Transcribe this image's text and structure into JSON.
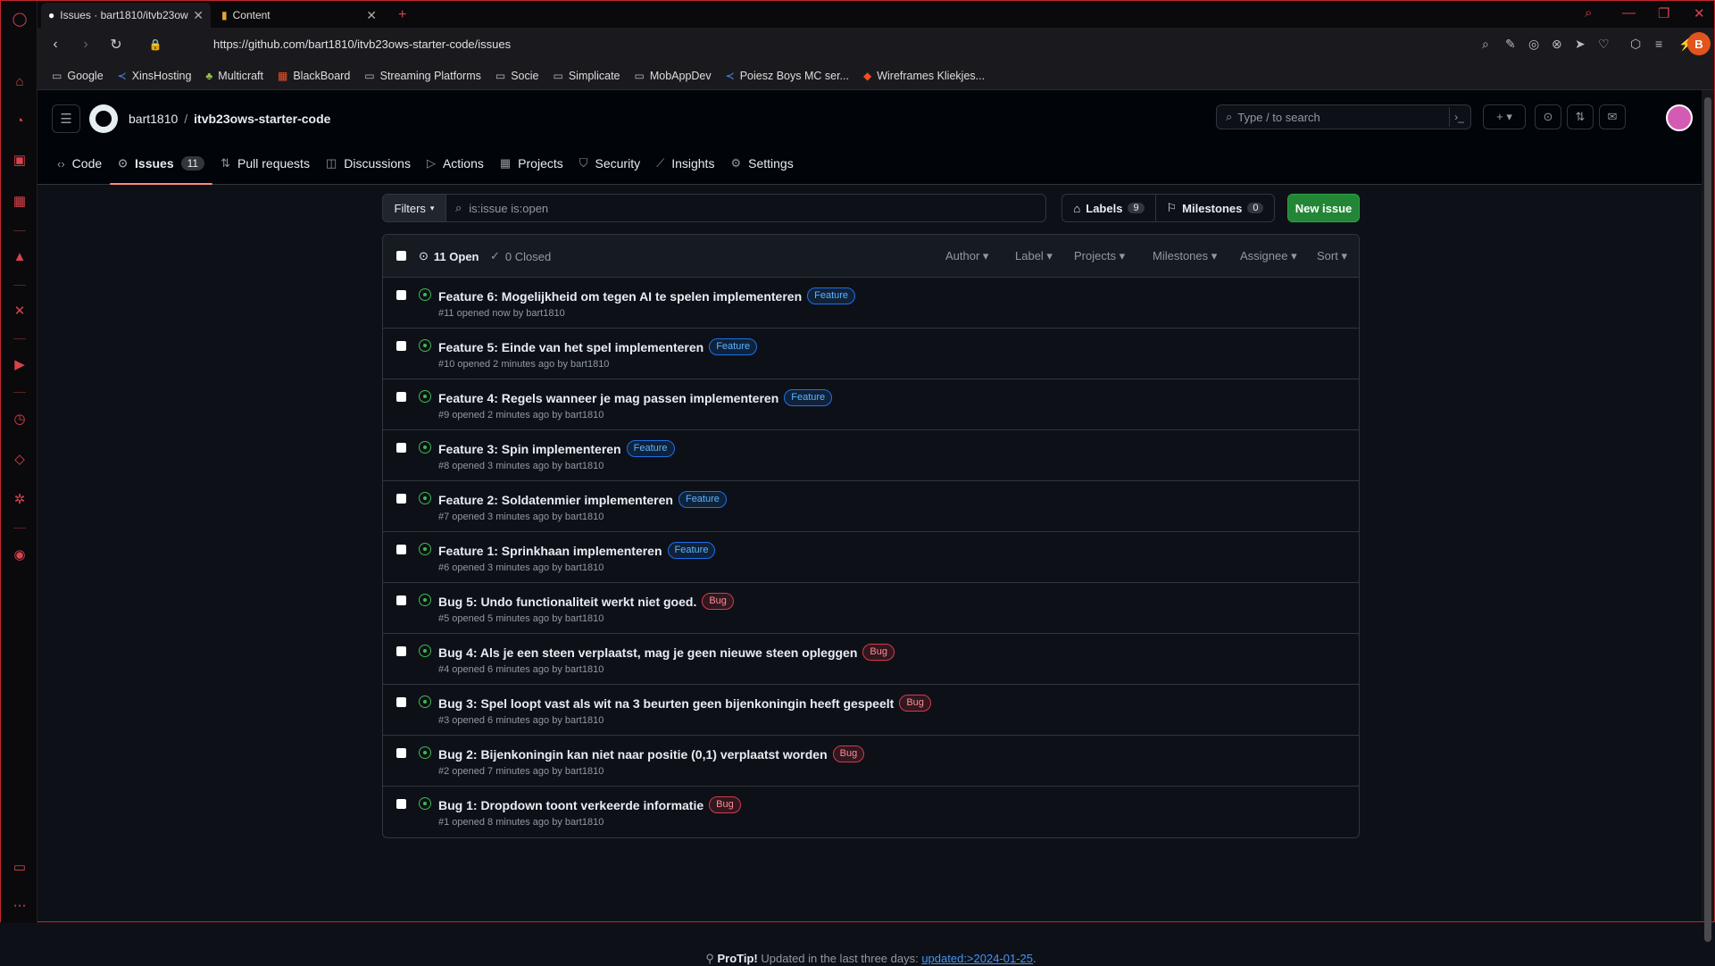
{
  "browser": {
    "tabs": [
      {
        "label": "Issues · bart1810/itvb23ow",
        "active": true
      },
      {
        "label": "Content",
        "active": false
      }
    ],
    "url": "https://github.com/bart1810/itvb23ows-starter-code/issues",
    "bookmarks": [
      "Google",
      "XinsHosting",
      "Multicraft",
      "BlackBoard",
      "Streaming Platforms",
      "Socie",
      "Simplicate",
      "MobAppDev",
      "Poiesz Boys MC ser...",
      "Wireframes Kliekjes..."
    ],
    "profile_initial": "B"
  },
  "header": {
    "owner": "bart1810",
    "separator": "/",
    "repo": "itvb23ows-starter-code",
    "search_placeholder": "Type / to search"
  },
  "repo_nav": [
    {
      "label": "Code",
      "icon": "code-icon"
    },
    {
      "label": "Issues",
      "icon": "issue-icon",
      "count": "11",
      "active": true
    },
    {
      "label": "Pull requests",
      "icon": "pull-request-icon"
    },
    {
      "label": "Discussions",
      "icon": "discussion-icon"
    },
    {
      "label": "Actions",
      "icon": "play-icon"
    },
    {
      "label": "Projects",
      "icon": "table-icon"
    },
    {
      "label": "Security",
      "icon": "shield-icon"
    },
    {
      "label": "Insights",
      "icon": "graph-icon"
    },
    {
      "label": "Settings",
      "icon": "gear-icon"
    }
  ],
  "toolbar": {
    "filters_label": "Filters",
    "query": "is:issue is:open",
    "labels_label": "Labels",
    "labels_count": "9",
    "milestones_label": "Milestones",
    "milestones_count": "0",
    "new_issue_label": "New issue"
  },
  "list_header": {
    "open_label": "11 Open",
    "closed_label": "0 Closed",
    "filters": [
      "Author",
      "Label",
      "Projects",
      "Milestones",
      "Assignee",
      "Sort"
    ]
  },
  "issues": [
    {
      "title": "Feature 6: Mogelijkheid om tegen AI te spelen implementeren",
      "label": "Feature",
      "meta": "#11 opened now by bart1810"
    },
    {
      "title": "Feature 5: Einde van het spel implementeren",
      "label": "Feature",
      "meta": "#10 opened 2 minutes ago by bart1810"
    },
    {
      "title": "Feature 4: Regels wanneer je mag passen implementeren",
      "label": "Feature",
      "meta": "#9 opened 2 minutes ago by bart1810"
    },
    {
      "title": "Feature 3: Spin implementeren",
      "label": "Feature",
      "meta": "#8 opened 3 minutes ago by bart1810"
    },
    {
      "title": "Feature 2: Soldatenmier implementeren",
      "label": "Feature",
      "meta": "#7 opened 3 minutes ago by bart1810"
    },
    {
      "title": "Feature 1: Sprinkhaan implementeren",
      "label": "Feature",
      "meta": "#6 opened 3 minutes ago by bart1810"
    },
    {
      "title": "Bug 5: Undo functionaliteit werkt niet goed.",
      "label": "Bug",
      "meta": "#5 opened 5 minutes ago by bart1810"
    },
    {
      "title": "Bug 4: Als je een steen verplaatst, mag je geen nieuwe steen opleggen",
      "label": "Bug",
      "meta": "#4 opened 6 minutes ago by bart1810"
    },
    {
      "title": "Bug 3: Spel loopt vast als wit na 3 beurten geen bijenkoningin heeft gespeelt",
      "label": "Bug",
      "meta": "#3 opened 6 minutes ago by bart1810"
    },
    {
      "title": "Bug 2: Bijenkoningin kan niet naar positie (0,1) verplaatst worden",
      "label": "Bug",
      "meta": "#2 opened 7 minutes ago by bart1810"
    },
    {
      "title": "Bug 1: Dropdown toont verkeerde informatie",
      "label": "Bug",
      "meta": "#1 opened 8 minutes ago by bart1810"
    }
  ],
  "protip": {
    "bold": "ProTip!",
    "text": " Updated in the last three days: ",
    "link": "updated:>2024-01-25",
    "end": "."
  },
  "colors": {
    "accent_red": "#d8434c",
    "green_button": "#238636",
    "open_green": "#3fb950",
    "feature_blue": "#1f6feb",
    "bug_red": "#d73a4a"
  }
}
